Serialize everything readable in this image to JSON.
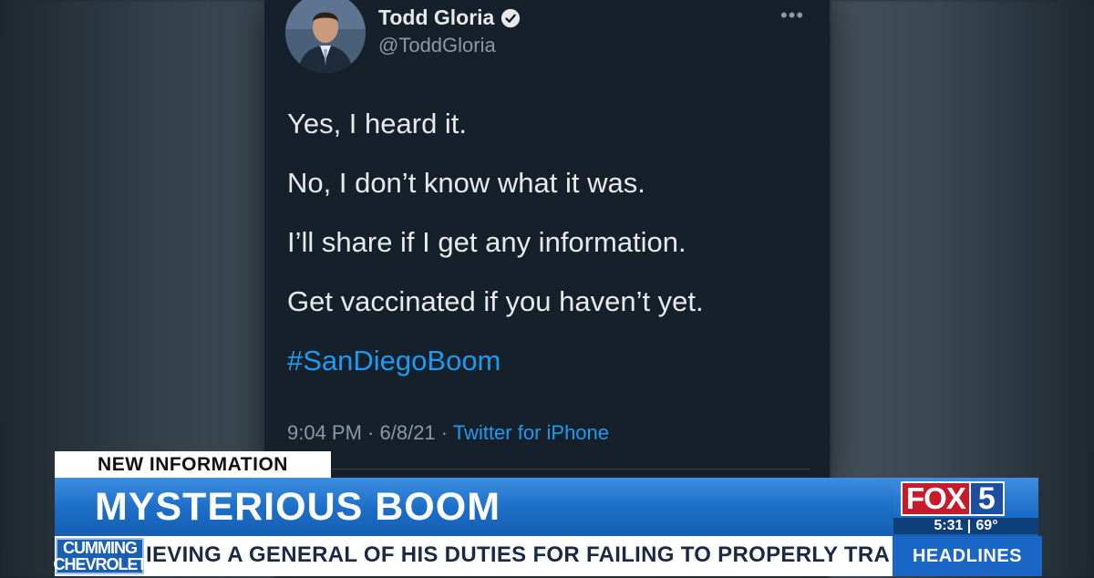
{
  "tweet": {
    "author_name": "Todd Gloria",
    "handle": "@ToddGloria",
    "more_label": "•••",
    "lines": [
      "Yes, I heard it.",
      "No, I don’t know what it was.",
      "I’ll share if I get any information.",
      "Get vaccinated if you haven’t yet."
    ],
    "hashtag": "#SanDiegoBoom",
    "time": "9:04 PM",
    "separator": " · ",
    "date": "6/8/21",
    "source": "Twitter for iPhone"
  },
  "lower_third": {
    "tag": "NEW INFORMATION",
    "headline": "MYSTERIOUS BOOM",
    "logo_fox": "FOX",
    "logo_num": "5",
    "clock": "5:31",
    "temperature": "69°"
  },
  "ticker": {
    "sponsor_line1": "CUMMING",
    "sponsor_line2": "CHEVROLET",
    "text": "IEVING A GENERAL OF HIS DUTIES FOR FAILING TO PROPERLY TRAIN",
    "section": "HEADLINES"
  },
  "colors": {
    "tweet_bg": "#15202b",
    "link_blue": "#1d9bf0",
    "headline_blue": "#1d6fc8",
    "fox_red": "#c81b2a"
  }
}
